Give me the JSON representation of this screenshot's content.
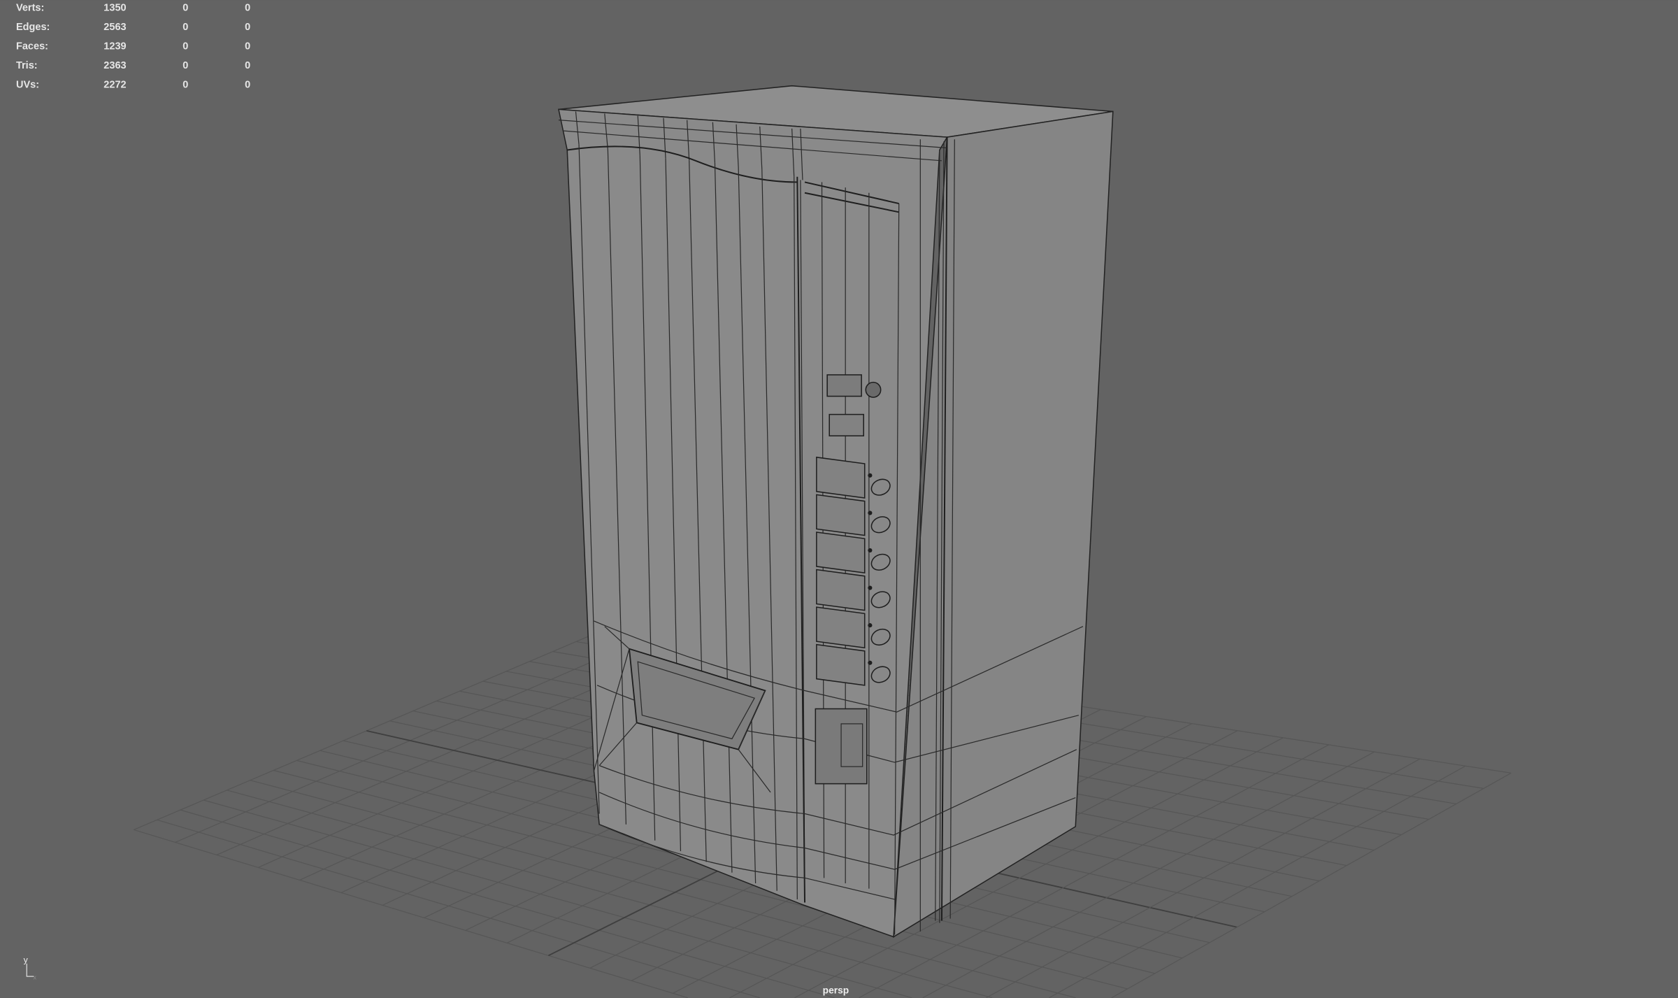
{
  "viewport": {
    "camera_label": "persp",
    "axis_labels": {
      "y": "y",
      "x": "x"
    },
    "colors": {
      "background": "#636363",
      "grid": "#555555",
      "front_face": "#8a8a8a",
      "side_face": "#858585",
      "top_face": "#8e8e8e"
    }
  },
  "heads_up_display": {
    "rows": [
      {
        "label": "Verts:",
        "value": "1350",
        "col2": "0",
        "col3": "0"
      },
      {
        "label": "Edges:",
        "value": "2563",
        "col2": "0",
        "col3": "0"
      },
      {
        "label": "Faces:",
        "value": "1239",
        "col2": "0",
        "col3": "0"
      },
      {
        "label": "Tris:",
        "value": "2363",
        "col2": "0",
        "col3": "0"
      },
      {
        "label": "UVs:",
        "value": "2272",
        "col2": "0",
        "col3": "0"
      }
    ]
  }
}
